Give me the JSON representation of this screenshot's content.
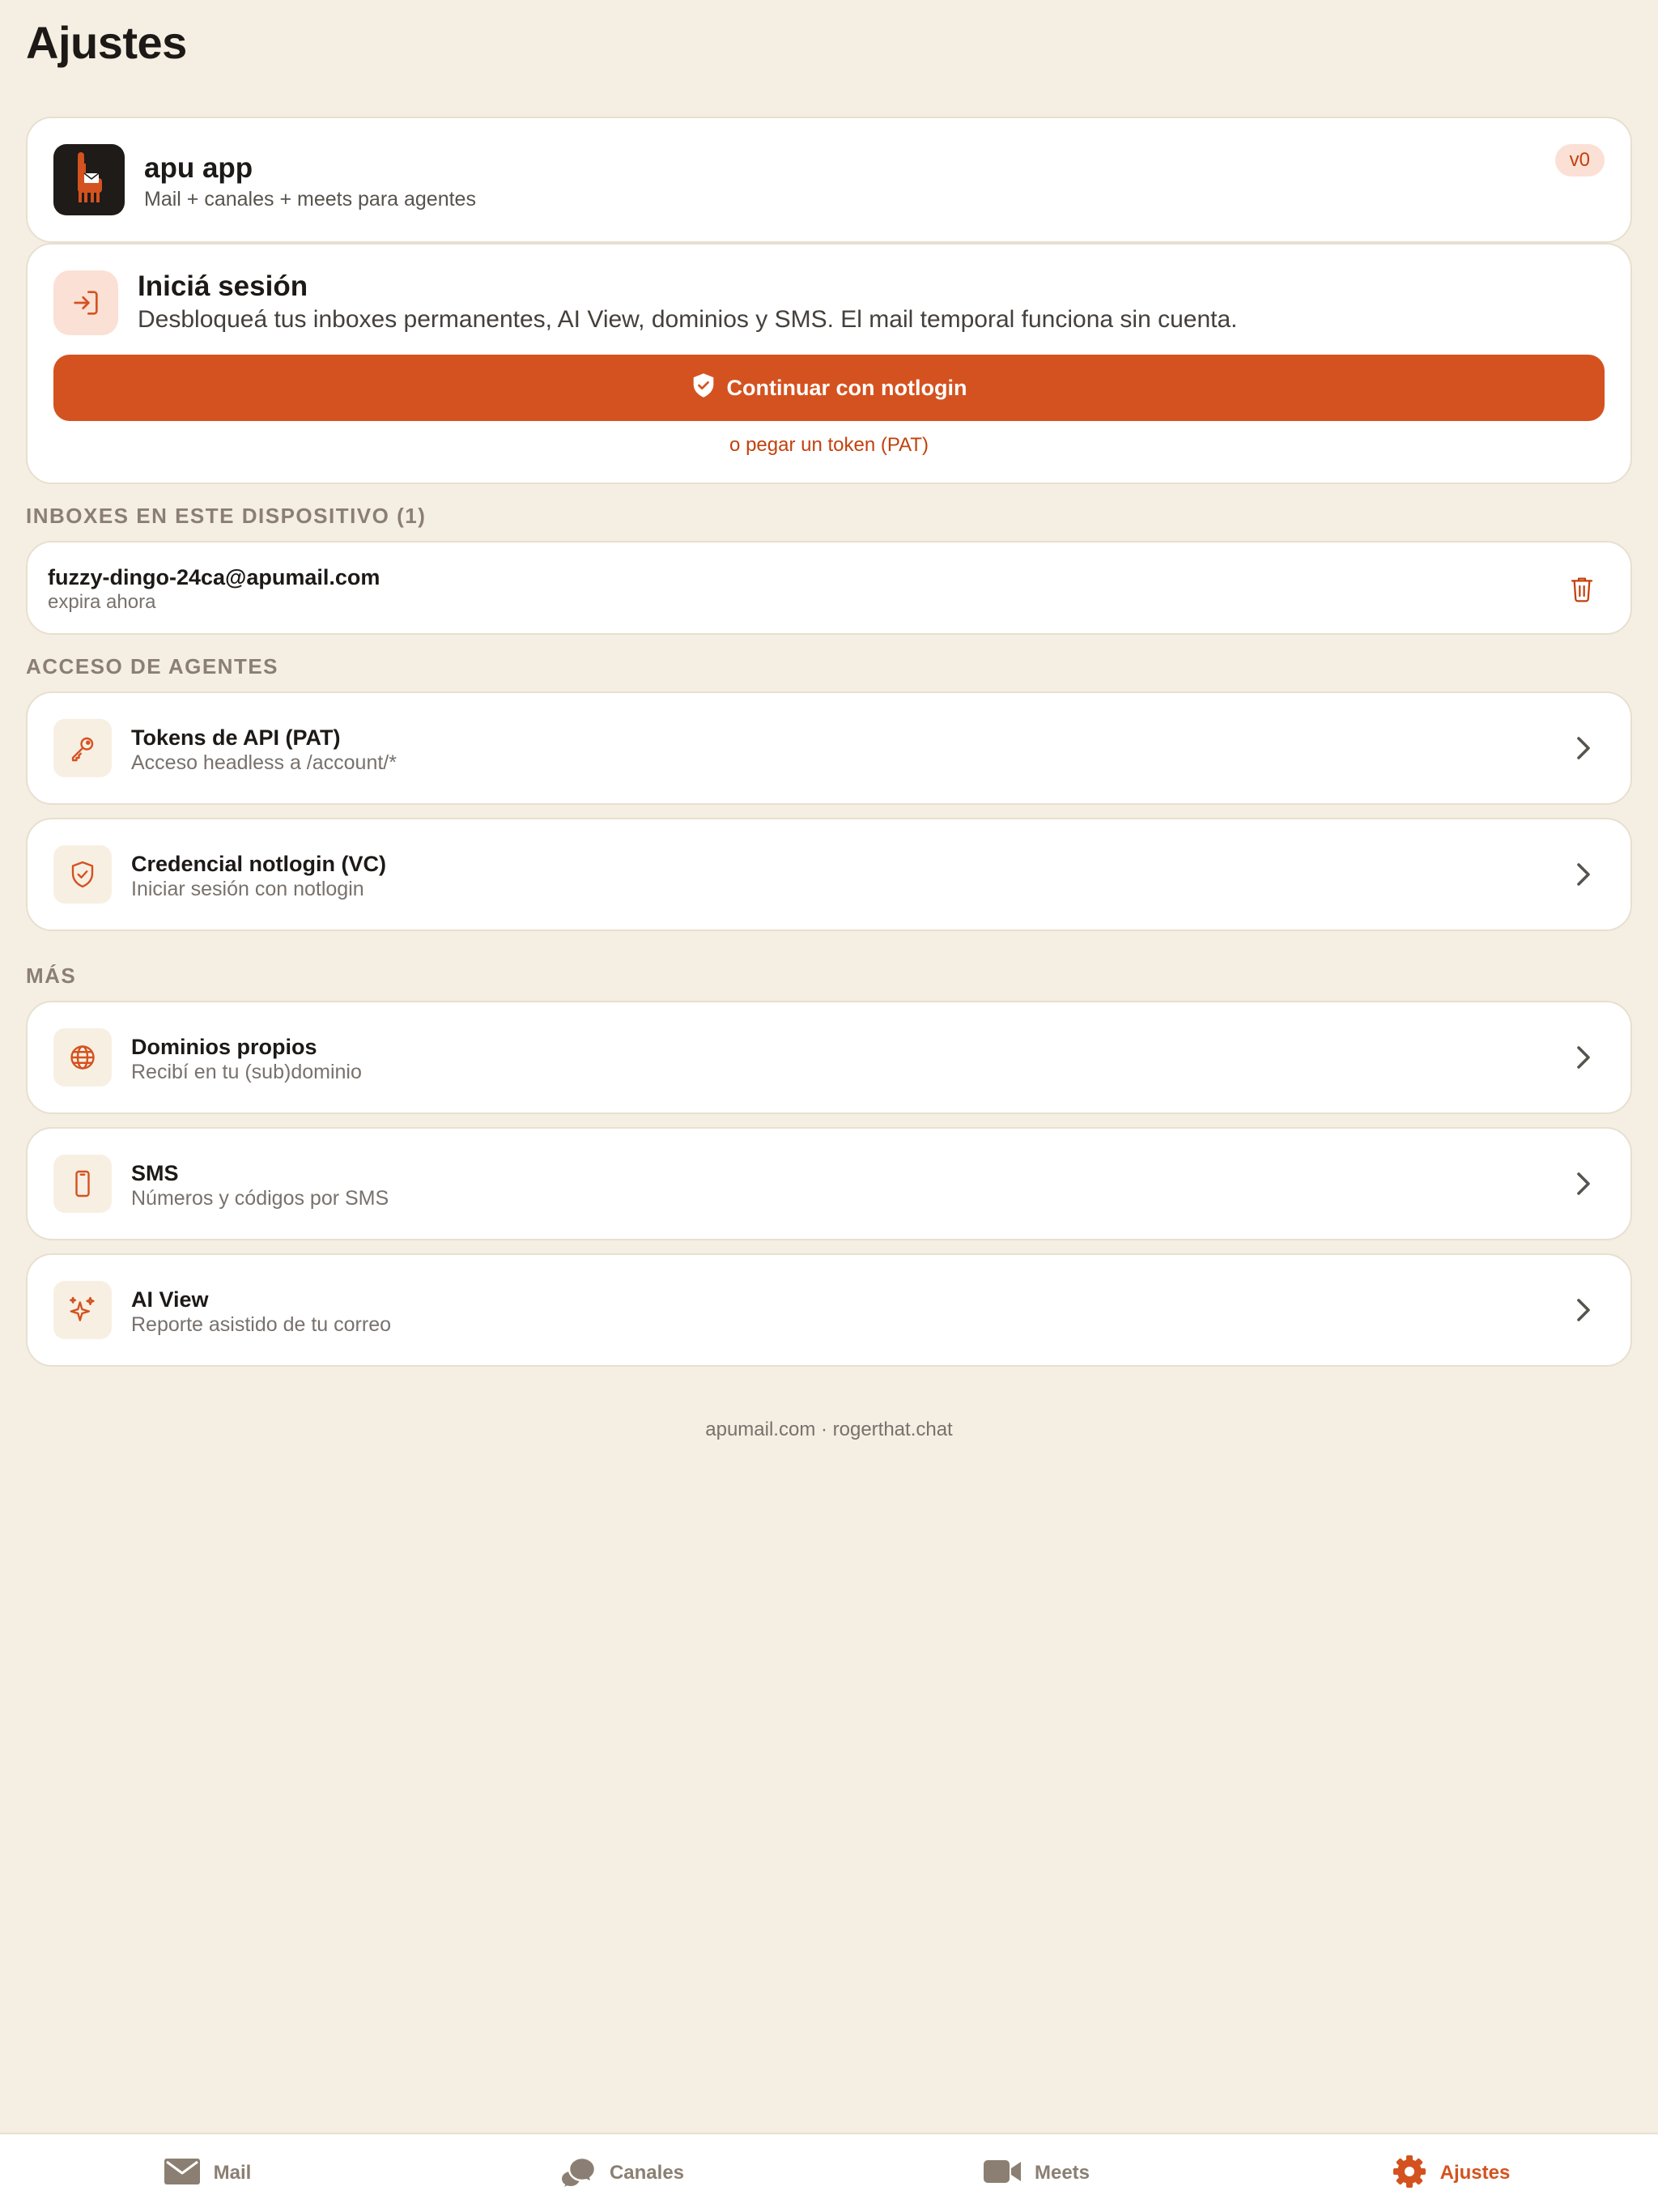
{
  "page": {
    "title": "Ajustes"
  },
  "app": {
    "name": "apu app",
    "subtitle": "Mail + canales + meets para agentes",
    "version": "v0"
  },
  "login": {
    "title": "Iniciá sesión",
    "description": "Desbloqueá tus inboxes permanentes, AI View, dominios y SMS. El mail temporal funciona sin cuenta.",
    "button_label": "Continuar con notlogin",
    "token_link": "o pegar un token (PAT)"
  },
  "inboxes": {
    "section_label": "INBOXES EN ESTE DISPOSITIVO (1)",
    "items": [
      {
        "address": "fuzzy-dingo-24ca@apumail.com",
        "expiry": "expira ahora"
      }
    ]
  },
  "agents": {
    "section_label": "ACCESO DE AGENTES",
    "items": [
      {
        "title": "Tokens de API (PAT)",
        "subtitle": "Acceso headless a /account/*",
        "icon": "key-icon"
      },
      {
        "title": "Credencial notlogin (VC)",
        "subtitle": "Iniciar sesión con notlogin",
        "icon": "shield-check-icon"
      }
    ]
  },
  "more": {
    "section_label": "MÁS",
    "items": [
      {
        "title": "Dominios propios",
        "subtitle": "Recibí en tu (sub)dominio",
        "icon": "globe-icon"
      },
      {
        "title": "SMS",
        "subtitle": "Números y códigos por SMS",
        "icon": "phone-icon"
      },
      {
        "title": "AI View",
        "subtitle": "Reporte asistido de tu correo",
        "icon": "sparkles-icon"
      }
    ]
  },
  "footer": {
    "links": "apumail.com · rogerthat.chat"
  },
  "tabs": [
    {
      "label": "Mail",
      "icon": "mail-icon",
      "active": false
    },
    {
      "label": "Canales",
      "icon": "chat-bubbles-icon",
      "active": false
    },
    {
      "label": "Meets",
      "icon": "video-icon",
      "active": false
    },
    {
      "label": "Ajustes",
      "icon": "gear-icon",
      "active": true
    }
  ],
  "colors": {
    "background": "#f5eee2",
    "accent": "#d4521f",
    "card": "#ffffff",
    "muted_text": "#78716c",
    "section_label": "#8a7f72",
    "danger": "#c2410c"
  }
}
